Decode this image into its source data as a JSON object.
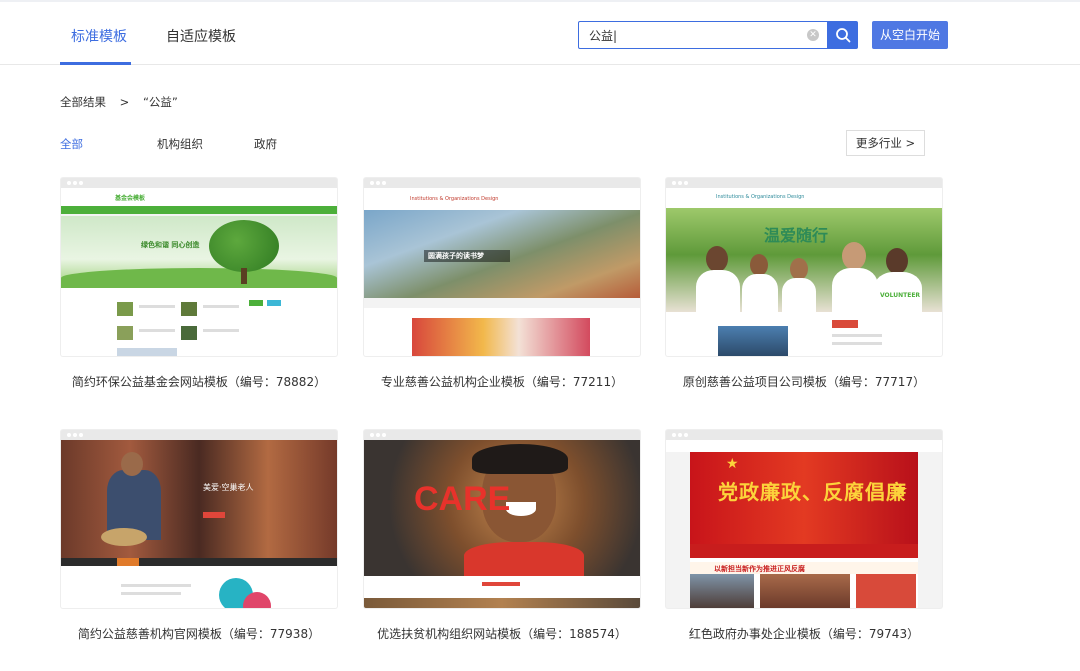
{
  "tabs": [
    {
      "label": "标准模板",
      "active": true
    },
    {
      "label": "自适应模板",
      "active": false
    }
  ],
  "search": {
    "value": "公益|",
    "button_icon": "search-icon"
  },
  "blank_button": "从空白开始",
  "breadcrumb": {
    "root": "全部结果",
    "separator": ">",
    "current": "“公益”"
  },
  "filters": [
    {
      "label": "全部",
      "active": true
    },
    {
      "label": "机构组织",
      "active": false
    },
    {
      "label": "政府",
      "active": false
    }
  ],
  "more_industries": "更多行业 >",
  "cards": [
    {
      "title": "简约环保公益基金会网站模板（编号：78882）",
      "thumb": {
        "brand": "基金会模板",
        "headline": "绿色和谐 同心创造"
      }
    },
    {
      "title": "专业慈善公益机构企业模板（编号：77211）",
      "thumb": {
        "brand": "Institutions & Organizations Design",
        "headline": "圆满孩子的读书梦"
      }
    },
    {
      "title": "原创慈善公益项目公司模板（编号：77717）",
      "thumb": {
        "brand": "Institutions & Organizations Design",
        "headline": "温爱随行",
        "tag": "VOLUNTEER"
      }
    },
    {
      "title": "简约公益慈善机构官网模板（编号：77938）",
      "thumb": {
        "headline": "美爱·空巢老人"
      }
    },
    {
      "title": "优选扶贫机构组织网站模板（编号：188574）",
      "thumb": {
        "headline": "CARE"
      }
    },
    {
      "title": "红色政府办事处企业模板（编号：79743）",
      "thumb": {
        "headline": "党政廉政、反腐倡廉",
        "news": "以新担当新作为推进正风反腐"
      }
    }
  ],
  "colors": {
    "accent": "#3d6de0",
    "button": "#4f78e3"
  }
}
